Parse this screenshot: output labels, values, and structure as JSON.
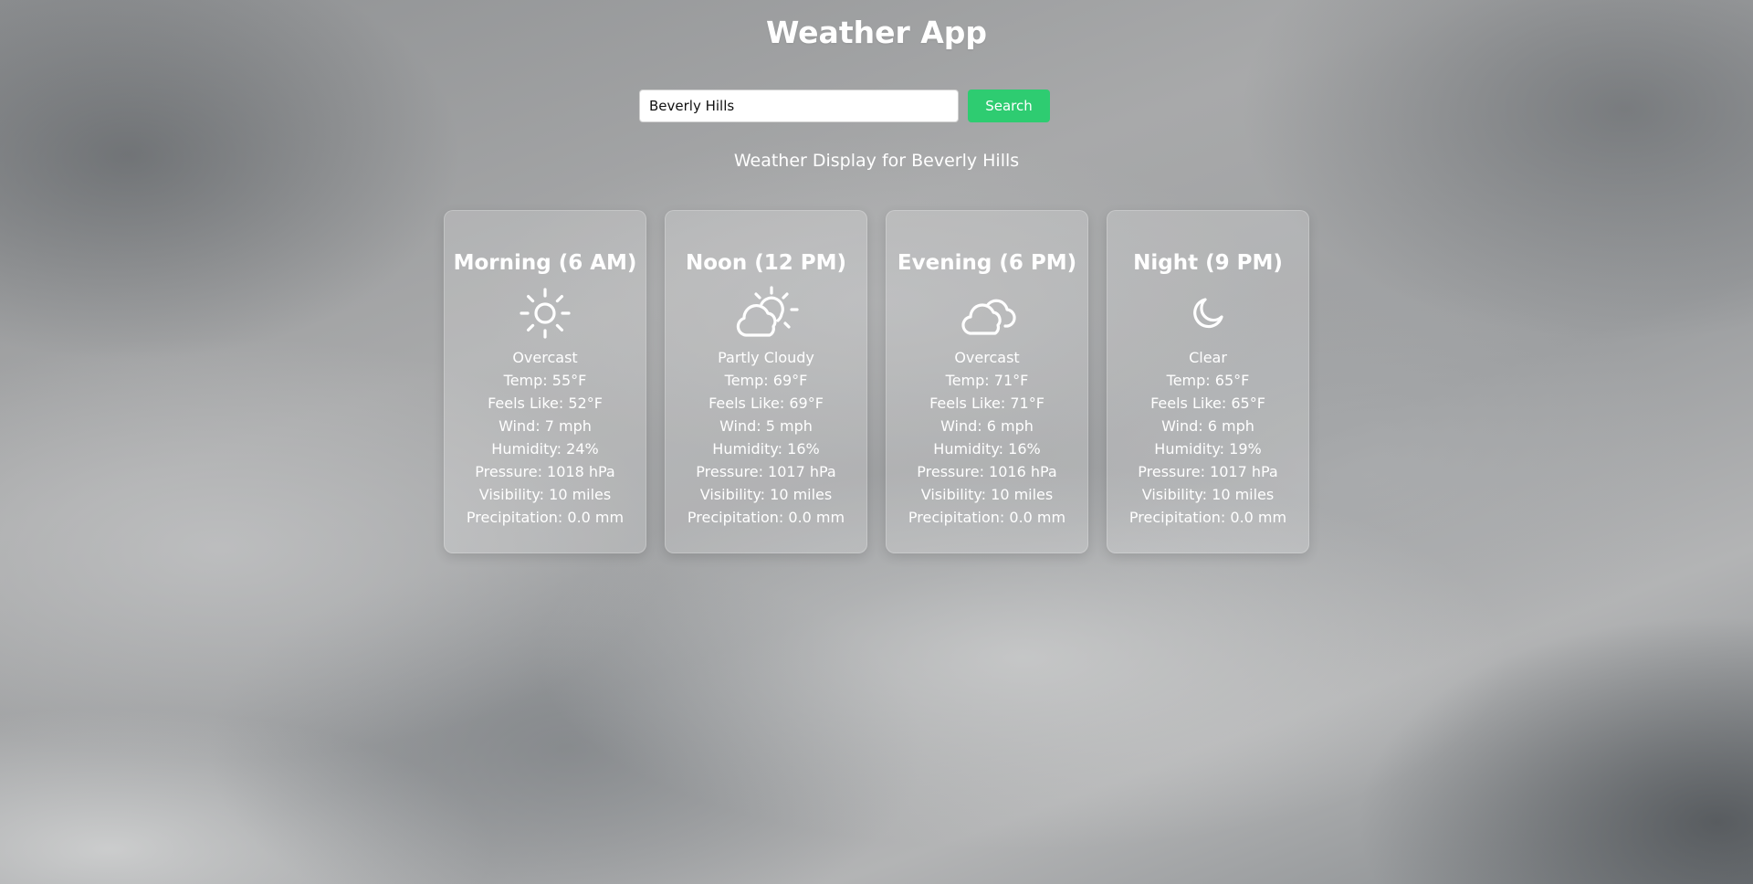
{
  "app": {
    "title": "Weather App"
  },
  "search": {
    "value": "Beverly Hills",
    "button_label": "Search"
  },
  "subtitle": "Weather Display for Beverly Hills",
  "colors": {
    "search_button": "#2ecc71"
  },
  "cards": [
    {
      "title": "Morning (6 AM)",
      "icon": "sun-icon",
      "condition": "Overcast",
      "temp": "Temp: 55°F",
      "feels_like": "Feels Like: 52°F",
      "wind": "Wind: 7 mph",
      "humidity": "Humidity: 24%",
      "pressure": "Pressure: 1018 hPa",
      "visibility": "Visibility: 10 miles",
      "precipitation": "Precipitation: 0.0 mm"
    },
    {
      "title": "Noon (12 PM)",
      "icon": "partly-cloudy-icon",
      "condition": "Partly Cloudy",
      "temp": "Temp: 69°F",
      "feels_like": "Feels Like: 69°F",
      "wind": "Wind: 5 mph",
      "humidity": "Humidity: 16%",
      "pressure": "Pressure: 1017 hPa",
      "visibility": "Visibility: 10 miles",
      "precipitation": "Precipitation: 0.0 mm"
    },
    {
      "title": "Evening (6 PM)",
      "icon": "cloud-icon",
      "condition": "Overcast",
      "temp": "Temp: 71°F",
      "feels_like": "Feels Like: 71°F",
      "wind": "Wind: 6 mph",
      "humidity": "Humidity: 16%",
      "pressure": "Pressure: 1016 hPa",
      "visibility": "Visibility: 10 miles",
      "precipitation": "Precipitation: 0.0 mm"
    },
    {
      "title": "Night (9 PM)",
      "icon": "moon-icon",
      "condition": "Clear",
      "temp": "Temp: 65°F",
      "feels_like": "Feels Like: 65°F",
      "wind": "Wind: 6 mph",
      "humidity": "Humidity: 19%",
      "pressure": "Pressure: 1017 hPa",
      "visibility": "Visibility: 10 miles",
      "precipitation": "Precipitation: 0.0 mm"
    }
  ]
}
